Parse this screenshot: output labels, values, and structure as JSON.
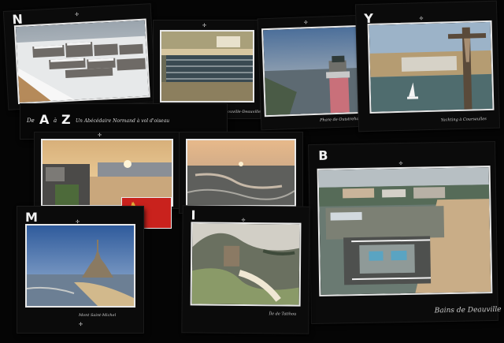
{
  "cards": {
    "n": {
      "letter": "N"
    },
    "jetee": {
      "caption": "Jetée de Trouville-Deauville"
    },
    "phare": {
      "caption": "Phare de Ouistreham"
    },
    "y": {
      "letter": "Y",
      "caption": "Yachting à Courseulles"
    },
    "az": {
      "title_de": "De",
      "title_a": "A",
      "title_middle": "à",
      "title_z": "Z",
      "subtitle": "Un Abécédaire Normand à vol d'oiseau"
    },
    "m": {
      "letter": "M",
      "caption": "Mont Saint-Michel"
    },
    "i": {
      "letter": "I",
      "caption": "Île de Tatihou"
    },
    "b": {
      "letter": "B",
      "caption": "Bains de Deauville"
    }
  },
  "ornament": "✢",
  "colors": {
    "background": "#050505",
    "frame": "#e8e8e8",
    "text": "#f2f2f2"
  }
}
